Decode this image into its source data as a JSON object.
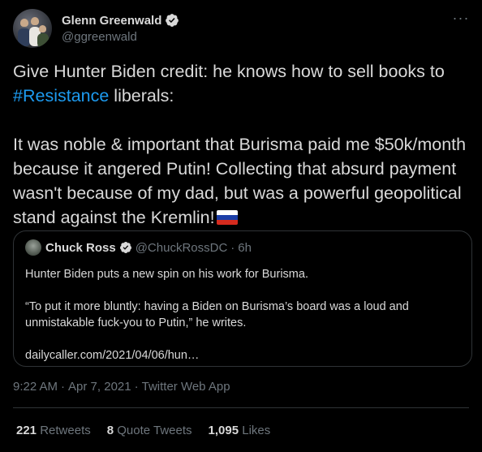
{
  "author": {
    "display_name": "Glenn Greenwald",
    "handle": "@ggreenwald",
    "verified_icon": "verified-badge-icon",
    "more_icon": "ellipsis-icon"
  },
  "tweet": {
    "line1_pre": "Give Hunter Biden credit: he knows how to sell books to ",
    "hashtag": "#Resistance",
    "line1_post": " liberals:",
    "paragraph2": "It was noble & important that Burisma paid me $50k/month because it angered Putin! Collecting that absurd payment wasn't because of my dad, but was a powerful geopolitical stand against the Kremlin!",
    "flag_icon": "russia-flag-icon"
  },
  "quote": {
    "display_name": "Chuck Ross",
    "handle": "@ChuckRossDC",
    "separator": "·",
    "time": "6h",
    "text1": "Hunter Biden puts a new spin on his work for Burisma.",
    "text2": "“To put it more bluntly: having a Biden on Burisma’s board was a loud and unmistakable fuck-you to Putin,” he writes.",
    "link": "dailycaller.com/2021/04/06/hun…"
  },
  "meta": {
    "time": "9:22 AM",
    "date": "Apr 7, 2021",
    "source": "Twitter Web App",
    "separator": "·"
  },
  "stats": {
    "retweets_count": "221",
    "retweets_label": "Retweets",
    "quotes_count": "8",
    "quotes_label": "Quote Tweets",
    "likes_count": "1,095",
    "likes_label": "Likes"
  },
  "colors": {
    "background": "#000000",
    "text": "#d9d9d9",
    "secondary": "#6e767d",
    "link": "#1d9bf0",
    "border": "#2f3336"
  }
}
